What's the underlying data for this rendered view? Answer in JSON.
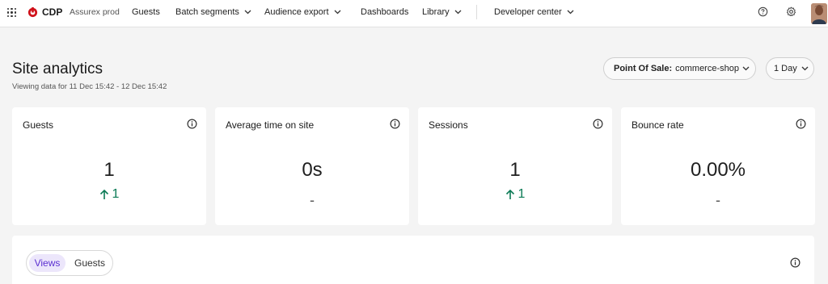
{
  "topbar": {
    "brand": "CDP",
    "tenant": "Assurex prod",
    "nav": [
      {
        "label": "Guests",
        "dropdown": false
      },
      {
        "label": "Batch segments",
        "dropdown": true
      },
      {
        "label": "Audience export",
        "dropdown": true
      },
      {
        "label": "Dashboards",
        "dropdown": false
      },
      {
        "label": "Library",
        "dropdown": true
      },
      {
        "label": "Developer center",
        "dropdown": true
      }
    ],
    "icons": [
      "apps-grid-icon",
      "cdp-logo-icon",
      "help-icon",
      "settings-gear-icon",
      "user-avatar"
    ]
  },
  "header": {
    "title": "Site analytics",
    "subtitle": "Viewing data for 11 Dec 15:42 - 12 Dec 15:42",
    "point_of_sale_label": "Point Of Sale:",
    "point_of_sale_value": "commerce-shop",
    "range_value": "1 Day"
  },
  "cards": [
    {
      "title": "Guests",
      "value": "1",
      "delta": "1",
      "delta_direction": "up"
    },
    {
      "title": "Average time on site",
      "value": "0s",
      "delta": "-",
      "delta_direction": "none"
    },
    {
      "title": "Sessions",
      "value": "1",
      "delta": "1",
      "delta_direction": "up"
    },
    {
      "title": "Bounce rate",
      "value": "0.00%",
      "delta": "-",
      "delta_direction": "none"
    }
  ],
  "chart_panel": {
    "tabs": [
      {
        "label": "Views",
        "active": true
      },
      {
        "label": "Guests",
        "active": false
      }
    ]
  },
  "colors": {
    "brand_red": "#d0121b",
    "positive_green": "#0b7a55",
    "active_tab_bg": "#ece6fb",
    "active_tab_text": "#5b2fd1"
  }
}
